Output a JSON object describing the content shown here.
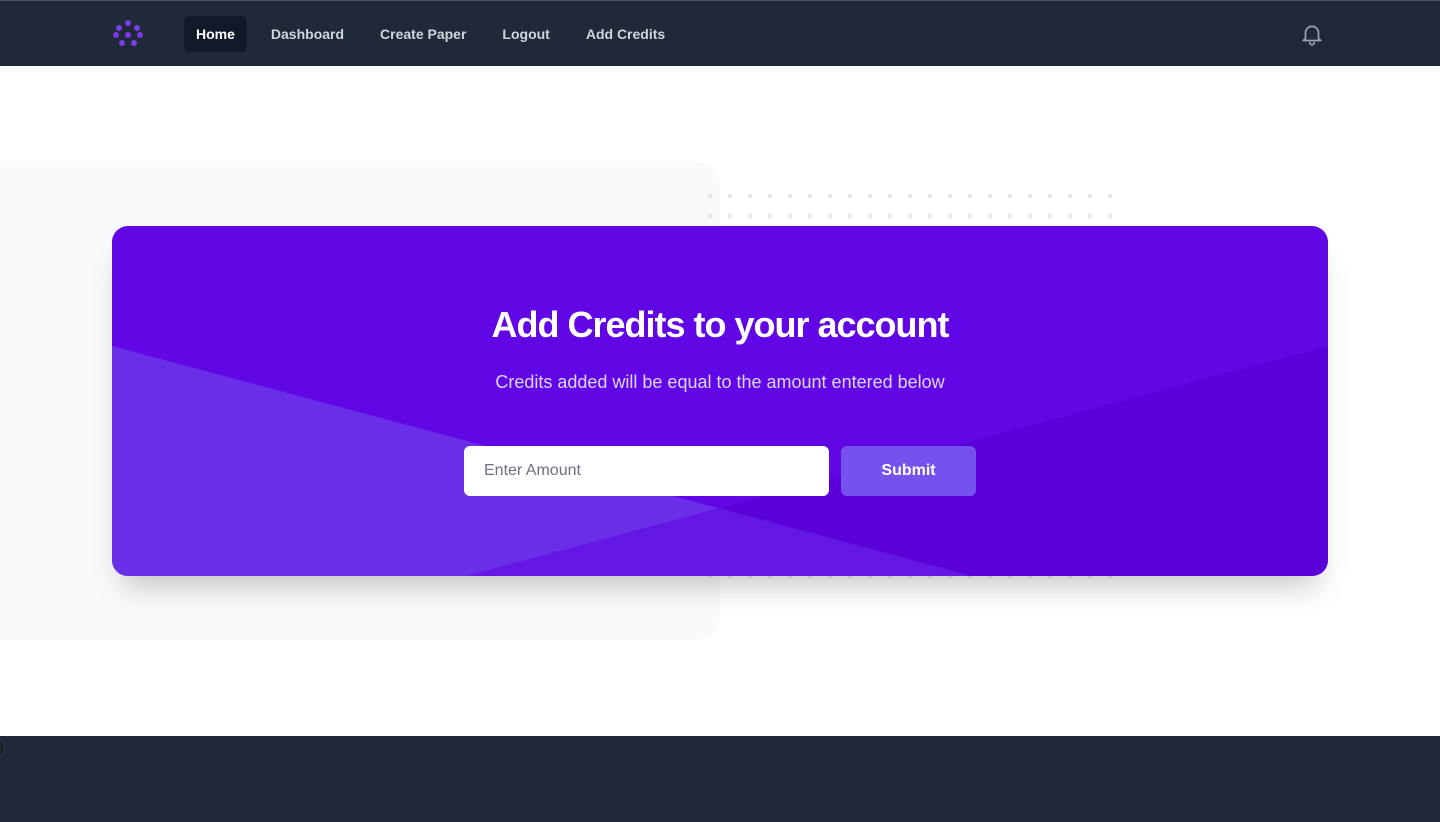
{
  "nav": {
    "logo_icon": "dots-cluster-logo-icon",
    "links": [
      {
        "label": "Home",
        "active": true
      },
      {
        "label": "Dashboard",
        "active": false
      },
      {
        "label": "Create Paper",
        "active": false
      },
      {
        "label": "Logout",
        "active": false
      },
      {
        "label": "Add Credits",
        "active": false
      }
    ],
    "notifications_icon": "bell-icon"
  },
  "card": {
    "title": "Add Credits to your account",
    "subtitle": "Credits added will be equal to the amount entered below",
    "amount_placeholder": "Enter Amount",
    "amount_value": "",
    "submit_label": "Submit"
  },
  "colors": {
    "navbar_bg": "#1f2937",
    "card_bg": "#6107e6",
    "accent_logo": "#7c3aed",
    "submit_bg": "#7552ee",
    "footer_bg": "#1f2937"
  }
}
